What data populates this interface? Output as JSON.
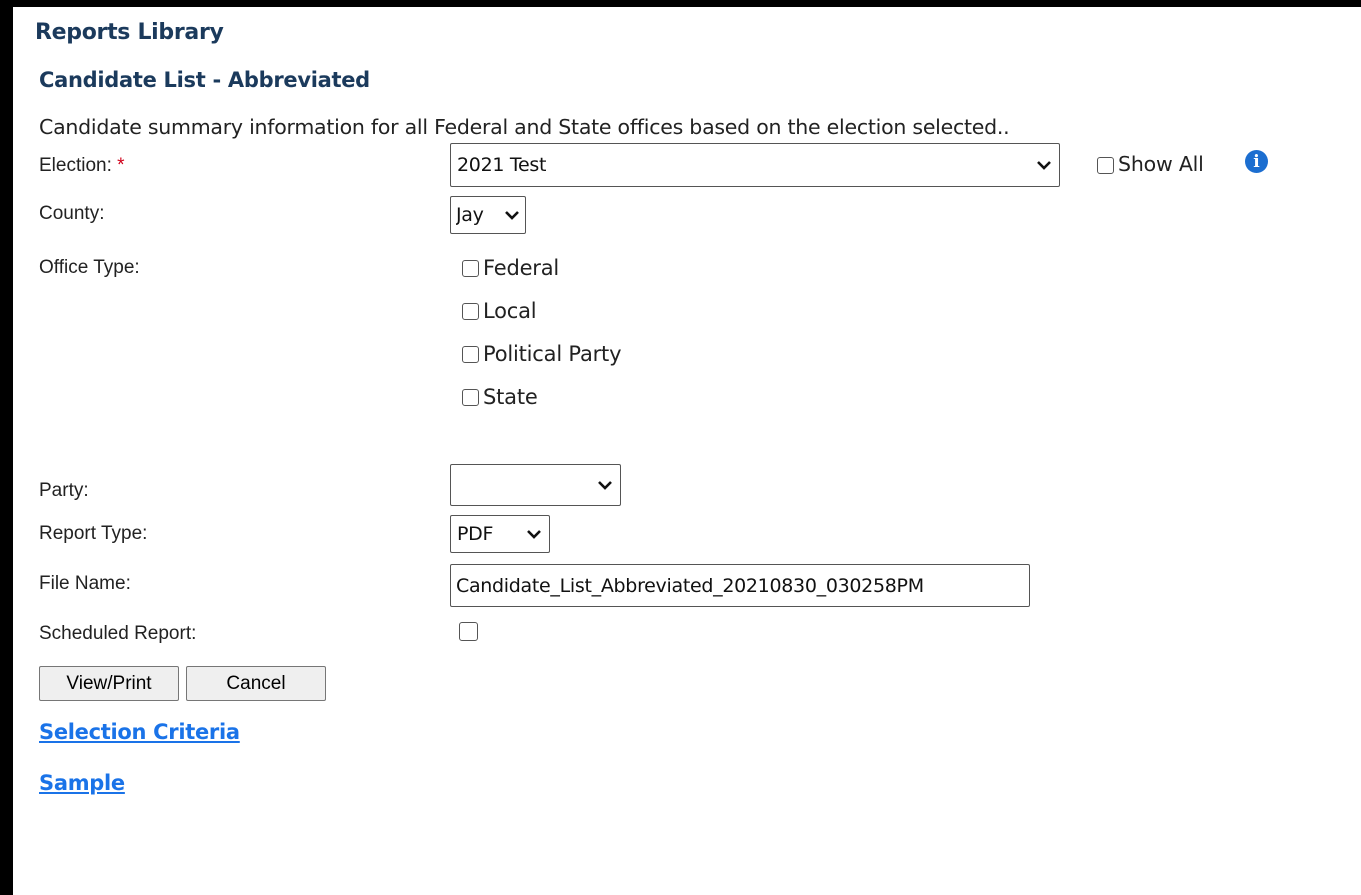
{
  "page": {
    "header": "Reports Library",
    "report_title": "Candidate List - Abbreviated",
    "description": "Candidate summary information for all Federal and State offices based on the election selected.."
  },
  "form": {
    "election": {
      "label": "Election:",
      "required_marker": "*",
      "value": "2021 Test"
    },
    "show_all": {
      "label": "Show All",
      "checked": false
    },
    "county": {
      "label": "County:",
      "value": "Jay"
    },
    "office_type": {
      "label": "Office Type:",
      "options": [
        {
          "label": "Federal",
          "checked": false
        },
        {
          "label": "Local",
          "checked": false
        },
        {
          "label": "Political Party",
          "checked": false
        },
        {
          "label": "State",
          "checked": false
        }
      ]
    },
    "party": {
      "label": "Party:",
      "value": ""
    },
    "report_type": {
      "label": "Report Type:",
      "value": "PDF"
    },
    "file_name": {
      "label": "File Name:",
      "value": "Candidate_List_Abbreviated_20210830_030258PM"
    },
    "scheduled_report": {
      "label": "Scheduled Report:",
      "checked": false
    }
  },
  "buttons": {
    "view_print": "View/Print",
    "cancel": "Cancel"
  },
  "links": {
    "selection_criteria": "Selection Criteria",
    "sample": "Sample"
  },
  "icons": {
    "info": "info-icon",
    "dropdown": "chevron-down-icon"
  },
  "colors": {
    "heading": "#1b3a5c",
    "link": "#1a73e8",
    "info_icon": "#1c6ed0",
    "required": "#d0021b",
    "frame": "#000000"
  }
}
